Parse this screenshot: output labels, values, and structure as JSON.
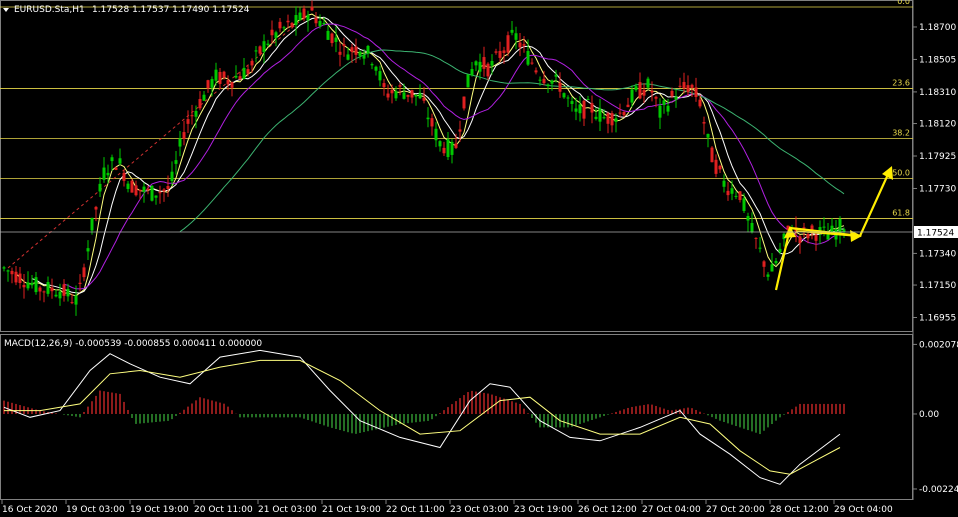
{
  "header": {
    "symbol_timeframe": "EURUSD.Sta,H1",
    "ohlc": "1.17528 1.17537 1.17490 1.17524"
  },
  "macd_header": "MACD(12,26,9) -0.000539 -0.000855 0.000411 0.000000",
  "price_marker": "1.17524",
  "colors": {
    "background": "#000000",
    "bull": "#00c800",
    "bear": "#e02020",
    "fib": "#e8d94a",
    "ma_fast": "#ffff80",
    "ma_mid": "#ffffff",
    "ma_slow": "#b020e0",
    "ma_long": "#3cb371",
    "macd_pos": "#b22222",
    "macd_neg": "#2e8b2e",
    "arrow": "#ffee00"
  },
  "chart_data": {
    "type": "candlestick",
    "price_axis": {
      "ticks": [
        "1.18700",
        "1.18505",
        "1.18310",
        "1.18120",
        "1.17925",
        "1.17730",
        "1.17524",
        "1.17340",
        "1.17150",
        "1.16955"
      ],
      "ylim": [
        1.1688,
        1.1885
      ]
    },
    "time_axis": [
      "16 Oct 2020",
      "19 Oct 03:00",
      "19 Oct 19:00",
      "20 Oct 11:00",
      "21 Oct 03:00",
      "21 Oct 19:00",
      "22 Oct 11:00",
      "23 Oct 03:00",
      "23 Oct 19:00",
      "26 Oct 12:00",
      "27 Oct 04:00",
      "27 Oct 20:00",
      "28 Oct 12:00",
      "29 Oct 04:00"
    ],
    "fibonacci": [
      {
        "level": "0.0",
        "price": 1.1882
      },
      {
        "level": "23.6",
        "price": 1.1833
      },
      {
        "level": "38.2",
        "price": 1.1803
      },
      {
        "level": "50.0",
        "price": 1.1779
      },
      {
        "level": "61.8",
        "price": 1.1755
      }
    ],
    "macd": {
      "name": "MACD(12,26,9)",
      "ticks": [
        "0.002078",
        "0.00",
        "-0.00224"
      ],
      "ylim": [
        -0.00245,
        0.00215
      ]
    }
  }
}
